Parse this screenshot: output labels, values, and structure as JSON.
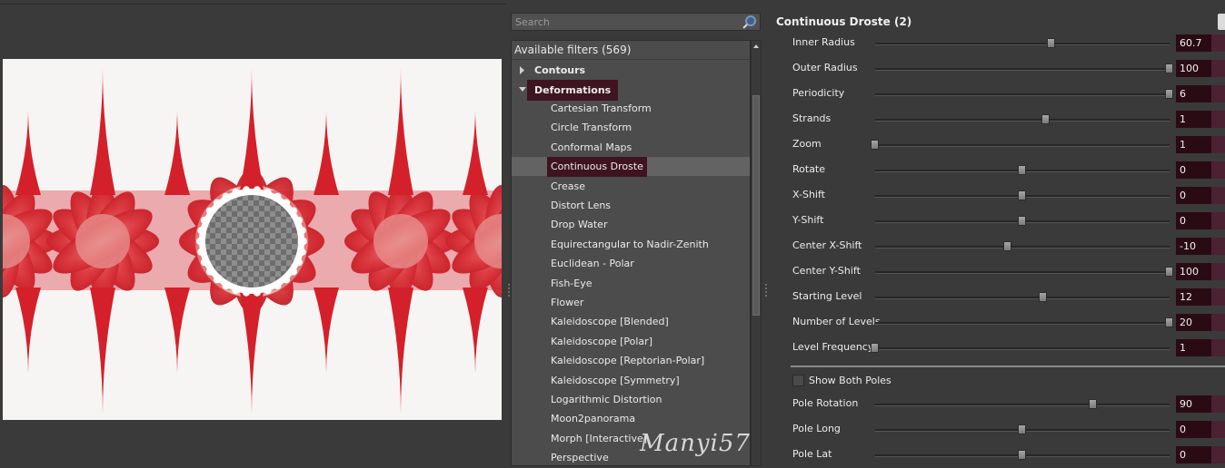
{
  "search": {
    "placeholder": "Search"
  },
  "filter_tree": {
    "header": "Available filters (569)",
    "categories": [
      {
        "label": "Contours",
        "expanded": false
      },
      {
        "label": "Deformations",
        "expanded": true,
        "highlighted": true
      }
    ],
    "items": [
      "Cartesian Transform",
      "Circle Transform",
      "Conformal Maps",
      "Continuous Droste",
      "Crease",
      "Distort Lens",
      "Drop Water",
      "Equirectangular to Nadir-Zenith",
      "Euclidean - Polar",
      "Fish-Eye",
      "Flower",
      "Kaleidoscope [Blended]",
      "Kaleidoscope [Polar]",
      "Kaleidoscope [Reptorian-Polar]",
      "Kaleidoscope [Symmetry]",
      "Logarithmic Distortion",
      "Moon2panorama",
      "Morph [Interactive]",
      "Perspective"
    ],
    "selected_item": "Continuous Droste"
  },
  "watermark": "Manyi57",
  "params": {
    "title": "Continuous Droste (2)",
    "sliders_top": [
      {
        "label": "Inner Radius",
        "value": "60.7",
        "fraction": 0.6
      },
      {
        "label": "Outer Radius",
        "value": "100",
        "fraction": 1.0
      },
      {
        "label": "Periodicity",
        "value": "6",
        "fraction": 1.0
      },
      {
        "label": "Strands",
        "value": "1",
        "fraction": 0.58
      },
      {
        "label": "Zoom",
        "value": "1",
        "fraction": 0.0
      },
      {
        "label": "Rotate",
        "value": "0",
        "fraction": 0.5
      },
      {
        "label": "X-Shift",
        "value": "0",
        "fraction": 0.5
      },
      {
        "label": "Y-Shift",
        "value": "0",
        "fraction": 0.5
      },
      {
        "label": "Center X-Shift",
        "value": "-10",
        "fraction": 0.45
      },
      {
        "label": "Center Y-Shift",
        "value": "100",
        "fraction": 1.0
      },
      {
        "label": "Starting Level",
        "value": "12",
        "fraction": 0.57
      },
      {
        "label": "Number of Levels",
        "value": "20",
        "fraction": 1.0
      },
      {
        "label": "Level Frequency",
        "value": "1",
        "fraction": 0.0
      }
    ],
    "show_both_poles": {
      "label": "Show Both Poles",
      "checked": false
    },
    "sliders_bottom": [
      {
        "label": "Pole Rotation",
        "value": "90",
        "fraction": 0.74
      },
      {
        "label": "Pole Long",
        "value": "0",
        "fraction": 0.5
      },
      {
        "label": "Pole Lat",
        "value": "0",
        "fraction": 0.5
      }
    ]
  },
  "colors": {
    "accent_highlight": "#3e1420",
    "value_box": "#2a0b14",
    "fractal_red": "#d4202a",
    "fractal_light": "#f3c9c0"
  }
}
